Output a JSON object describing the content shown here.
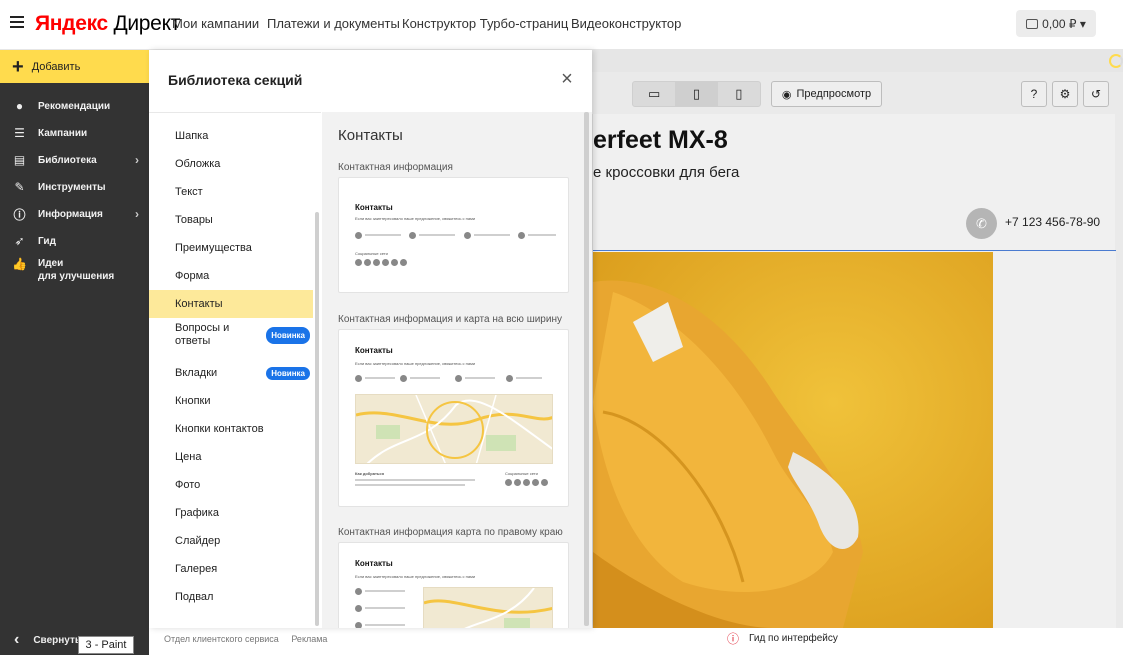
{
  "header": {
    "logo_brand": "Яндекс",
    "logo_product": "Директ",
    "nav": [
      "Мои кампании",
      "Платежи и документы",
      "Конструктор Турбо-страниц",
      "Видеоконструктор"
    ],
    "balance": "0,00 ₽ ▾"
  },
  "sidebar": {
    "add_label": "Добавить",
    "items": [
      {
        "label": "Рекомендации",
        "icon": "bulb-icon"
      },
      {
        "label": "Кампании",
        "icon": "list-icon"
      },
      {
        "label": "Библиотека",
        "icon": "library-icon"
      },
      {
        "label": "Инструменты",
        "icon": "wrench-icon"
      },
      {
        "label": "Информация",
        "icon": "info-icon"
      },
      {
        "label": "Гид",
        "icon": "rocket-icon"
      },
      {
        "label": "Идеи",
        "label2": "для улучшения",
        "icon": "thumbs-up-icon"
      }
    ],
    "collapse_label": "Свернуть"
  },
  "panel": {
    "title": "Библиотека секций",
    "categories": [
      {
        "label": "Шапка"
      },
      {
        "label": "Обложка"
      },
      {
        "label": "Текст"
      },
      {
        "label": "Товары"
      },
      {
        "label": "Преимущества"
      },
      {
        "label": "Форма"
      },
      {
        "label": "Контакты"
      },
      {
        "label": "Вопросы и",
        "label2": "ответы",
        "badge": "Новинка"
      },
      {
        "label": "Вкладки",
        "badge": "Новинка"
      },
      {
        "label": "Кнопки"
      },
      {
        "label": "Кнопки контактов"
      },
      {
        "label": "Цена"
      },
      {
        "label": "Фото"
      },
      {
        "label": "Графика"
      },
      {
        "label": "Слайдер"
      },
      {
        "label": "Галерея"
      },
      {
        "label": "Подвал"
      }
    ],
    "section_title": "Контакты",
    "variants": [
      {
        "label": "Контактная информация",
        "mini_title": "Контакты",
        "mini_text": "Если вас заинтересовало наше предложение, свяжитесь с нами",
        "mini_social": "Социальные сети"
      },
      {
        "label": "Контактная информация и карта на всю ширину",
        "mini_title": "Контакты",
        "mini_text": "Если вас заинтересовало наше предложение, свяжитесь с нами",
        "mini_howto": "Как добраться",
        "mini_social": "Социальные сети"
      },
      {
        "label": "Контактная информация карта по правому краю",
        "mini_title": "Контакты",
        "mini_text": "Если вас заинтересовало наше предложение, свяжитесь с нами"
      }
    ]
  },
  "footer": {
    "links": [
      "Отдел клиентского сервиса",
      "Реклама"
    ],
    "guide": "Гид по интерфейсу",
    "taskbar_tip": "3 - Paint"
  },
  "editor": {
    "preview_label": "Предпросмотр",
    "hero_title": "erfeet MX-8",
    "hero_subtitle": "е кроссовки для бега",
    "phone": "+7 123 456-78-90"
  }
}
